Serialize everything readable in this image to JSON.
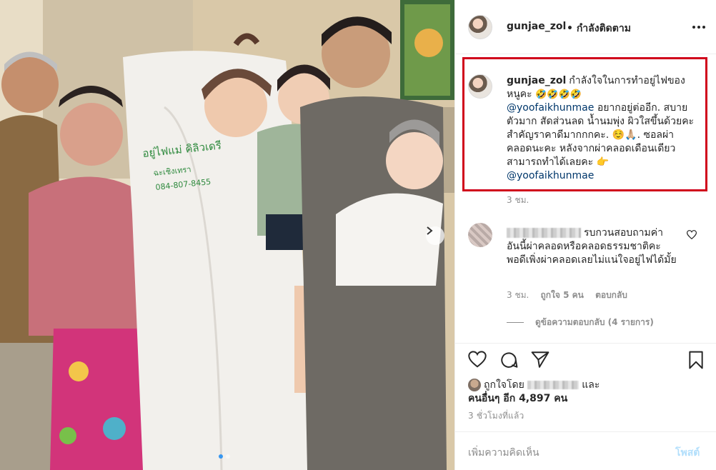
{
  "colors": {
    "highlight_box": "#d0021b",
    "link": "#00376b",
    "meta_text": "#8e8e8e",
    "post_button_disabled": "#b2dffc"
  },
  "header": {
    "username": "gunjae_zol",
    "follow_status": "• กำลังติดตาม",
    "more_icon": "more-horizontal-icon"
  },
  "caption": {
    "username": "gunjae_zol",
    "text_1": "กำลังใจในการทำอยู่ไฟของหนูคะ",
    "emojis": "🤣🤣🤣🤣",
    "mention_1": "@yoofaikhunmae",
    "text_2": " อยากอยู่ต่ออีก. สบายตัวมาก สัดส่วนลด น้ำนมพุ่ง ผิวใสขึ้นด้วยคะ สำคัญราคาดีมากกกคะ. ☺️🙏🏼. ซอลผ่าคลอดนะคะ หลังจากผ่าคลอดเดือนเดียวสามารถทำได้เลยคะ 👉",
    "mention_2": "@yoofaikhunmae",
    "time": "3 ชม."
  },
  "comment": {
    "text": "รบกวนสอบถามค่า อันนี้ผ่าคลอดหรือคลอดธรรมชาติคะ พอดีเพิ่งผ่าคลอดเลยไม่แน่ใจอยู่ไฟได้มั้ย",
    "time": "3 ชม.",
    "likes": "ถูกใจ 5 คน",
    "reply": "ตอบกลับ",
    "view_replies": "ดูข้อความตอบกลับ (4 รายการ)"
  },
  "actions": {
    "icons": [
      "heart-icon",
      "comment-icon",
      "share-icon",
      "bookmark-icon"
    ],
    "liked_by_prefix": "ถูกใจโดย",
    "liked_by_and": "และ",
    "liked_by_others": "คนอื่นๆ อีก 4,897 คน",
    "post_time": "3 ชั่วโมงที่แล้ว"
  },
  "add_comment": {
    "placeholder": "เพิ่มความคิดเห็น",
    "post_label": "โพสต์"
  },
  "photo": {
    "sign_line_1": "อยู่ไฟแม่ คิลิวเดรี",
    "sign_line_2": "ฉะเชิงเทรา",
    "sign_line_3": "084-807-8455",
    "slide_count": 2,
    "active_slide": 1
  }
}
